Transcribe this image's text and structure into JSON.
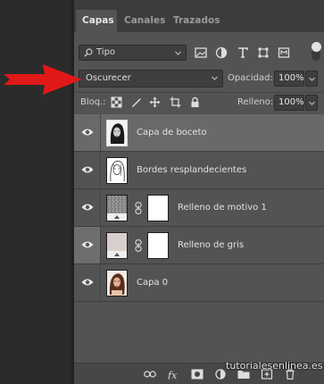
{
  "tabs": [
    "Capas",
    "Canales",
    "Trazados"
  ],
  "filter": {
    "kind_label": "Tipo"
  },
  "blend": {
    "mode": "Oscurecer",
    "opacity_label": "Opacidad:",
    "opacity_value": "100%"
  },
  "lock": {
    "label": "Bloq.:",
    "fill_label": "Relleno:",
    "fill_value": "100%"
  },
  "layers": [
    {
      "name": "Capa de boceto"
    },
    {
      "name": "Bordes resplandecientes"
    },
    {
      "name": "Relleno de motivo 1"
    },
    {
      "name": "Relleno de gris"
    },
    {
      "name": "Capa 0"
    }
  ],
  "watermark": "tutorialesenlinea.es",
  "colors": {
    "panel": "#535353",
    "selected_row": "#696969",
    "arrow": "#e01818"
  }
}
